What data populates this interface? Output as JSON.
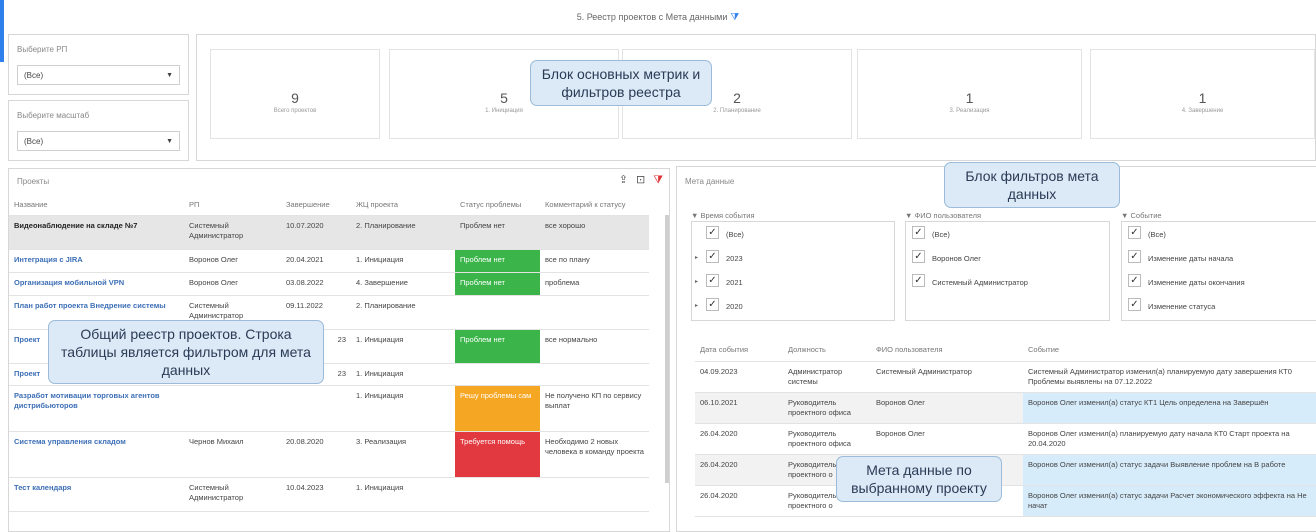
{
  "page_title": "5. Реестр проектов с Мета данными",
  "filters": [
    {
      "label": "Выберите РП",
      "value": "(Все)"
    },
    {
      "label": "Выберите масштаб",
      "value": "(Все)"
    }
  ],
  "metrics": [
    {
      "value": "9",
      "label": "Всего проектов"
    },
    {
      "value": "5",
      "label": "1. Инициация"
    },
    {
      "value": "2",
      "label": "2. Планирование"
    },
    {
      "value": "1",
      "label": "3. Реализация"
    },
    {
      "value": "1",
      "label": "4. Завершение"
    }
  ],
  "callouts": {
    "metrics": "Блок основных метрик и фильтров реестра",
    "meta_filters": "Блок фильтров мета данных",
    "registry": "Общий реестр проектов. Строка таблицы является фильтром для мета данных",
    "meta_data": "Мета данные по выбранному проекту"
  },
  "projects": {
    "title": "Проекты",
    "columns": [
      "Название",
      "РП",
      "Завершение",
      "ЖЦ проекта",
      "Статус проблемы",
      "Комментарий к статусу"
    ],
    "rows": [
      {
        "name": "Видеонаблюдение на складе №7",
        "pm": "Системный Администратор",
        "end": "10.07.2020",
        "stage": "2. Планирование",
        "status": "Проблем нет",
        "status_color": "none",
        "comment": "все хорошо"
      },
      {
        "name": "Интеграция с JIRA",
        "pm": "Воронов Олег",
        "end": "20.04.2021",
        "stage": "1. Инициация",
        "status": "Проблем нет",
        "status_color": "green",
        "comment": "все по плану"
      },
      {
        "name": "Организация мобильной VPN",
        "pm": "Воронов Олег",
        "end": "03.08.2022",
        "stage": "4. Завершение",
        "status": "Проблем нет",
        "status_color": "green",
        "comment": "проблема"
      },
      {
        "name": "План работ проекта Внедрение системы",
        "pm": "Системный Администратор",
        "end": "09.11.2022",
        "stage": "2. Планирование",
        "status": "",
        "status_color": "none",
        "comment": ""
      },
      {
        "name": "Проект",
        "pm": "",
        "end": "23",
        "stage": "1. Инициация",
        "status": "Проблем нет",
        "status_color": "green",
        "comment": "все нормально"
      },
      {
        "name": "Проект",
        "pm": "",
        "end": "23",
        "stage": "1. Инициация",
        "status": "",
        "status_color": "none",
        "comment": ""
      },
      {
        "name": "Разработ мотивации торговых агентов дистрибьюторов",
        "pm": "",
        "end": "",
        "stage": "1. Инициация",
        "status": "Решу проблемы сам",
        "status_color": "orange",
        "comment": "Не получено КП по сервису выплат"
      },
      {
        "name": "Система управления складом",
        "pm": "Чернов Михаил",
        "end": "20.08.2020",
        "stage": "3. Реализация",
        "status": "Требуется помощь",
        "status_color": "red",
        "comment": "Необходимо 2 новых человека в команду проекта"
      },
      {
        "name": "Тест календаря",
        "pm": "Системный Администратор",
        "end": "10.04.2023",
        "stage": "1. Инициация",
        "status": "",
        "status_color": "none",
        "comment": ""
      }
    ]
  },
  "meta": {
    "title": "Мета данные",
    "filter_columns": [
      {
        "title": "▼ Время события",
        "items": [
          {
            "label": "(Все)",
            "expand": ""
          },
          {
            "label": "2023",
            "expand": "▸"
          },
          {
            "label": "2021",
            "expand": "▸"
          },
          {
            "label": "2020",
            "expand": "▸"
          }
        ]
      },
      {
        "title": "▼ ФИО пользователя",
        "items": [
          {
            "label": "(Все)",
            "expand": ""
          },
          {
            "label": "Воронов Олег",
            "expand": ""
          },
          {
            "label": "Системный Администратор",
            "expand": ""
          }
        ]
      },
      {
        "title": "▼ Событие",
        "items": [
          {
            "label": "(Все)",
            "expand": ""
          },
          {
            "label": "Изменение даты начала",
            "expand": ""
          },
          {
            "label": "Изменение даты окончания",
            "expand": ""
          },
          {
            "label": "Изменение статуса",
            "expand": ""
          }
        ]
      }
    ],
    "columns": [
      "Дата события",
      "Должность",
      "ФИО пользователя",
      "Событие"
    ],
    "rows": [
      {
        "date": "04.09.2023",
        "role": "Администратор системы",
        "user": "Системный Администратор",
        "event": "Системный Администратор изменил(а) планируемую дату завершения КТ0 Проблемы выявлены на 07.12.2022",
        "highlight": false
      },
      {
        "date": "06.10.2021",
        "role": "Руководитель проектного офиса",
        "user": "Воронов Олег",
        "event": "Воронов Олег изменил(а) статус КТ1 Цель определена на Завершён",
        "highlight": true
      },
      {
        "date": "26.04.2020",
        "role": "Руководитель проектного офиса",
        "user": "Воронов Олег",
        "event": "Воронов Олег изменил(а) планируемую дату начала КТ0 Старт проекта на 20.04.2020",
        "highlight": false
      },
      {
        "date": "26.04.2020",
        "role": "Руководитель проектного о",
        "user": "",
        "event": "Воронов Олег изменил(а) статус задачи Выявление проблем на В работе",
        "highlight": true
      },
      {
        "date": "26.04.2020",
        "role": "Руководитель проектного о",
        "user": "",
        "event": "Воронов Олег изменил(а) статус задачи Расчет экономического эффекта на Не начат",
        "highlight": true
      }
    ]
  }
}
